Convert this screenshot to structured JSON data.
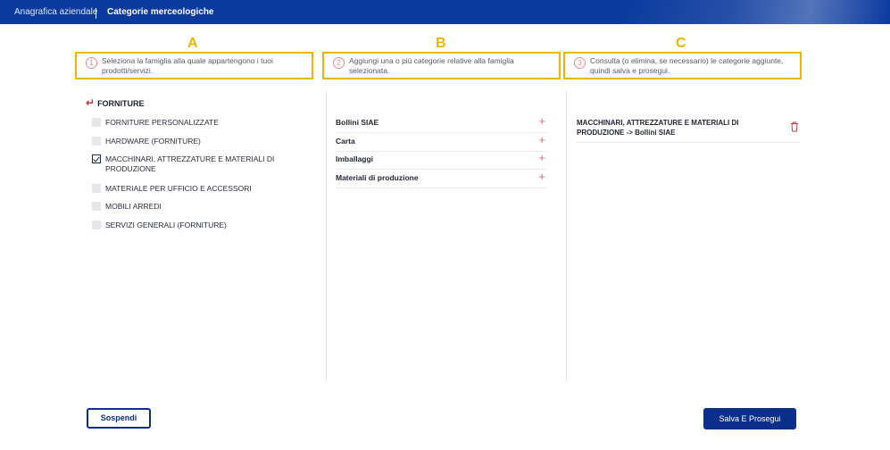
{
  "header": {
    "tabs": [
      {
        "label": "Anagrafica aziendale"
      },
      {
        "label": "Categorie merceologiche"
      }
    ]
  },
  "steps": [
    {
      "letter": "A",
      "number": "1",
      "text": "Seleziona la famiglia alla quale appartengono i tuoi prodotti/servizi."
    },
    {
      "letter": "B",
      "number": "2",
      "text": "Aggiungi una o più categorie relative alla famiglia selezionata."
    },
    {
      "letter": "C",
      "number": "3",
      "text": "Consulta (o elimina, se necessario) le categorie aggiunte, quindi salva e prosegui."
    }
  ],
  "families": {
    "back_label": "FORNITURE",
    "items": [
      {
        "label": "FORNITURE PERSONALIZZATE",
        "checked": false
      },
      {
        "label": "HARDWARE (FORNITURE)",
        "checked": false
      },
      {
        "label": "MACCHINARI, ATTREZZATURE E MATERIALI DI PRODUZIONE",
        "checked": true
      },
      {
        "label": "MATERIALE PER UFFICIO E ACCESSORI",
        "checked": false
      },
      {
        "label": "MOBILI ARREDI",
        "checked": false
      },
      {
        "label": "SERVIZI GENERALI (FORNITURE)",
        "checked": false
      }
    ]
  },
  "subcategories": {
    "items": [
      {
        "label": "Bollini SIAE"
      },
      {
        "label": "Carta"
      },
      {
        "label": "Imballaggi"
      },
      {
        "label": "Materiali di produzione"
      }
    ]
  },
  "selected": {
    "items": [
      {
        "label": "MACCHINARI, ATTREZZATURE E MATERIALI DI PRODUZIONE -> Bollini SIAE"
      }
    ]
  },
  "footer": {
    "suspend_label": "Sospendi",
    "save_label": "Salva E Prosegui"
  },
  "colors": {
    "brand": "#0a3aa0",
    "highlight": "#f0b400",
    "accent_red": "#e06a6a"
  }
}
